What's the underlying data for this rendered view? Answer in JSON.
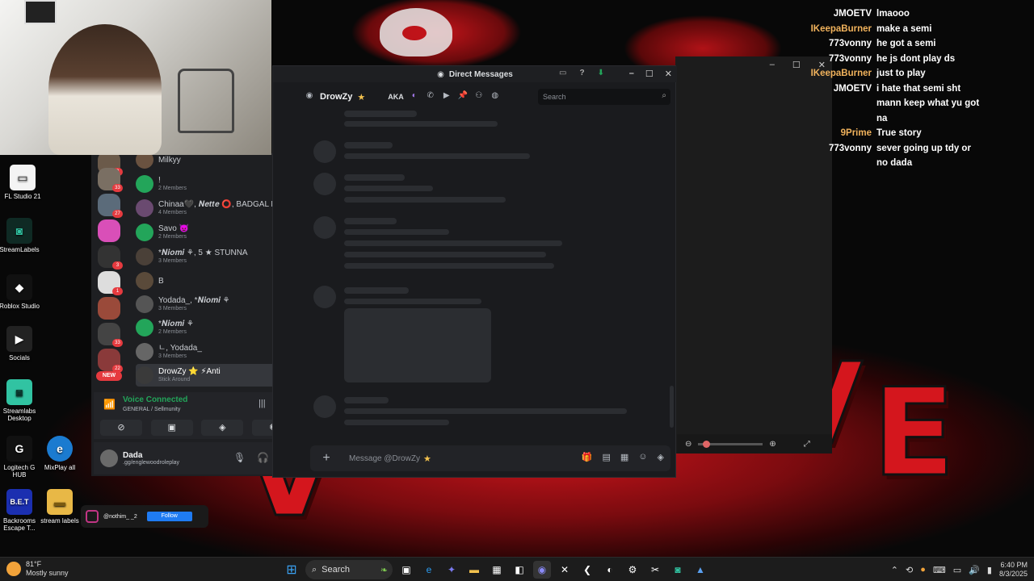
{
  "colors": {
    "discord_bg": "#1a1b1e",
    "accent_green": "#23a55a",
    "chat_orange": "#f0b25c",
    "chat_white": "#ffffff",
    "badge_red": "#e63a3f"
  },
  "desktop_icons": [
    {
      "label": "FL Studio 21",
      "icon": "file-icon"
    },
    {
      "label": "StreamLabels",
      "icon": "streamlabels-icon"
    },
    {
      "label": "Roblox Studio",
      "icon": "roblox-icon"
    },
    {
      "label": "Socials",
      "icon": "play-icon"
    },
    {
      "label": "Streamlabs Desktop",
      "icon": "streamlabs-icon"
    },
    {
      "label": "Logitech G HUB",
      "icon": "logitech-icon"
    },
    {
      "label": "MixPlay all",
      "icon": "edge-icon"
    },
    {
      "label": "Backrooms Escape T...",
      "icon": "game-icon"
    },
    {
      "label": "stream labels",
      "icon": "folder-icon"
    }
  ],
  "discord": {
    "window_title": "Direct Messages",
    "dm_name": "DrowZy",
    "aka_label": "AKA",
    "search_placeholder": "Search",
    "composer_placeholder": "Message @DrowZy",
    "new_badge": "NEW",
    "dm_list": [
      {
        "name": "Milkyy",
        "sub": ""
      },
      {
        "name": "!",
        "sub": "2 Members"
      },
      {
        "name": "Chinaa🖤, 𝑵𝒆𝒕𝒕𝒆 ⭕, BADGAL R...",
        "sub": "4 Members"
      },
      {
        "name": "Savo 👿",
        "sub": "2 Members"
      },
      {
        "name": "*𝑵𝒊𝒐𝒎𝒊 ⚘, 5 ★ STUNNA",
        "sub": "3 Members"
      },
      {
        "name": "B",
        "sub": ""
      },
      {
        "name": "Yodada_, *𝑵𝒊𝒐𝒎𝒊 ⚘",
        "sub": "3 Members"
      },
      {
        "name": "*𝑵𝒊𝒐𝒎𝒊 ⚘",
        "sub": "2 Members"
      },
      {
        "name": "ㄴ, Yodada_",
        "sub": "3 Members"
      },
      {
        "name": "DrowZy ⭐ ⚡Anti",
        "sub": "Stick Around"
      }
    ],
    "server_badges": [
      "3",
      "33",
      "27",
      "3",
      "1",
      "33",
      "22"
    ],
    "voice": {
      "status": "Voice Connected",
      "channel": "GENERAL / Sellmunity"
    },
    "user": {
      "name": "Dada",
      "status": ".gg/englewoodroleplay"
    }
  },
  "chat": [
    {
      "user": "JMOETV",
      "color": "#ffffff",
      "msg": "lmaooo"
    },
    {
      "user": "IKeepaBurner",
      "color": "#f0b25c",
      "msg": "make a semi"
    },
    {
      "user": "773vonny",
      "color": "#ffffff",
      "msg": "he got a semi"
    },
    {
      "user": "773vonny",
      "color": "#ffffff",
      "msg": "he js dont play ds"
    },
    {
      "user": "IKeepaBurner",
      "color": "#f0b25c",
      "msg": "just to play"
    },
    {
      "user": "JMOETV",
      "color": "#ffffff",
      "msg": "i hate that semi sht mann keep what yu got na"
    },
    {
      "user": "9Prime",
      "color": "#f0b25c",
      "msg": "True story"
    },
    {
      "user": "773vonny",
      "color": "#ffffff",
      "msg": "sever going up tdy or no dada"
    }
  ],
  "instagram": {
    "handle": "@nothim_ _2",
    "follow_label": "Follow"
  },
  "taskbar": {
    "weather_temp": "81°F",
    "weather_desc": "Mostly sunny",
    "search_label": "Search",
    "time": "6:40 PM",
    "date": "8/3/2025"
  }
}
